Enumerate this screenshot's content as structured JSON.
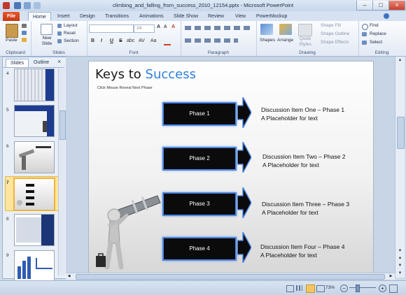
{
  "window": {
    "title": "climbing_and_falling_from_success_2010_12154.pptx - Microsoft PowerPoint"
  },
  "tabs": [
    "File",
    "Home",
    "Insert",
    "Design",
    "Transitions",
    "Animations",
    "Slide Show",
    "Review",
    "View",
    "PowerMockup"
  ],
  "ribbon": {
    "clipboard": {
      "paste": "Paste",
      "label": "Clipboard"
    },
    "slides": {
      "new_slide": "New Slide",
      "layout": "Layout",
      "reset": "Reset",
      "section": "Section",
      "label": "Slides"
    },
    "font": {
      "size": "24",
      "label": "Font",
      "bold": "B",
      "italic": "I",
      "underline": "U",
      "strike": "S",
      "shadow": "abc",
      "spacing": "AV",
      "case": "Aa",
      "grow": "A",
      "shrink": "A",
      "clear": "A"
    },
    "paragraph": {
      "label": "Paragraph"
    },
    "drawing": {
      "shapes": "Shapes",
      "arrange": "Arrange",
      "quick_styles": "Quick Styles",
      "shape_fill": "Shape Fill",
      "shape_outline": "Shape Outline",
      "shape_effects": "Shape Effects",
      "label": "Drawing"
    },
    "editing": {
      "find": "Find",
      "replace": "Replace",
      "select": "Select",
      "label": "Editing"
    }
  },
  "left_panel": {
    "tabs": [
      "Slides",
      "Outline"
    ],
    "close": "×",
    "slide_numbers": [
      "4",
      "5",
      "6",
      "7",
      "8",
      "9"
    ],
    "selected": "7"
  },
  "slide": {
    "title_main": "Keys to ",
    "title_accent": "Success",
    "subtitle": "Click Mouse Reveal Next Phase",
    "phases": [
      {
        "label": "Phase 1",
        "line1": "Discussion Item One – Phase 1",
        "line2": "A Placeholder for text"
      },
      {
        "label": "Phase 2",
        "line1": "Discussion Item Two – Phase 2",
        "line2": "A Placeholder for text"
      },
      {
        "label": "Phase 3",
        "line1": "Discussion Item Three – Phase 3",
        "line2": "A Placeholder for text"
      },
      {
        "label": "Phase 4",
        "line1": "Discussion Item Four – Phase 4",
        "line2": "A Placeholder for text"
      }
    ]
  },
  "status": {
    "zoom": "73%"
  },
  "colors": {
    "accent": "#2f7fe0",
    "phase_border": "#4a86e0",
    "file_tab": "#d14b1e",
    "selected_slide": "#f2b23c"
  }
}
